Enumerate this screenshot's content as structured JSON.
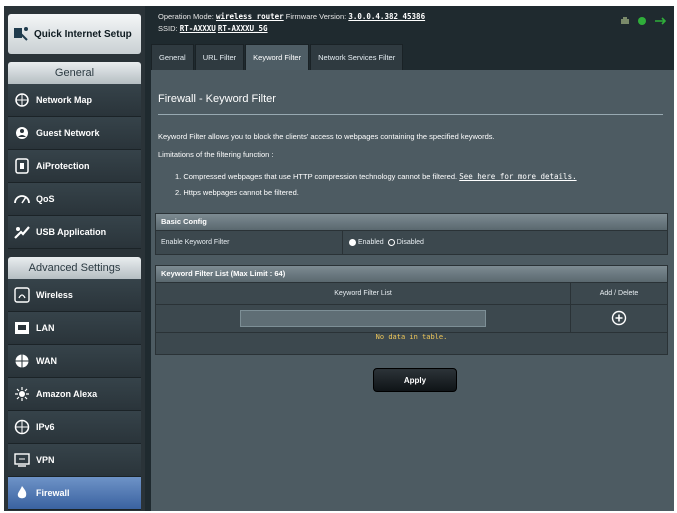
{
  "header": {
    "operation_mode_label": "Operation Mode:",
    "operation_mode_value": "wireless router",
    "firmware_label": "Firmware Version:",
    "firmware_value": "3.0.0.4.382_45386",
    "ssid_label": "SSID:",
    "ssid_1": "RT-AXXXU",
    "ssid_2": "RT-AXXXU_5G"
  },
  "sidebar": {
    "quick_setup": "Quick Internet Setup",
    "general_header": "General",
    "general_items": [
      {
        "label": "Network Map",
        "icon": "network-map-icon"
      },
      {
        "label": "Guest Network",
        "icon": "guest-network-icon"
      },
      {
        "label": "AiProtection",
        "icon": "shield-icon"
      },
      {
        "label": "QoS",
        "icon": "speedometer-icon"
      },
      {
        "label": "USB Application",
        "icon": "puzzle-icon"
      }
    ],
    "advanced_header": "Advanced Settings",
    "advanced_items": [
      {
        "label": "Wireless",
        "icon": "wifi-icon"
      },
      {
        "label": "LAN",
        "icon": "lan-icon"
      },
      {
        "label": "WAN",
        "icon": "globe-icon"
      },
      {
        "label": "Amazon Alexa",
        "icon": "alexa-icon"
      },
      {
        "label": "IPv6",
        "icon": "ipv6-globe-icon"
      },
      {
        "label": "VPN",
        "icon": "vpn-icon"
      },
      {
        "label": "Firewall",
        "icon": "firewall-icon"
      }
    ]
  },
  "tabs": [
    "General",
    "URL Filter",
    "Keyword Filter",
    "Network Services Filter"
  ],
  "active_tab": "Keyword Filter",
  "page": {
    "title": "Firewall - Keyword Filter",
    "description": "Keyword Filter allows you to block the clients' access to webpages containing the specified keywords.",
    "limitations_heading": "Limitations of the filtering function :",
    "limitation_1": "1. Compressed webpages that use HTTP compression technology cannot be filtered.",
    "limitation_1_link": "See here for more details.",
    "limitation_2": "2. Https webpages cannot be filtered."
  },
  "basic_config": {
    "header": "Basic Config",
    "enable_label": "Enable Keyword Filter",
    "option_enabled": "Enabled",
    "option_disabled": "Disabled",
    "selected": "Enabled"
  },
  "keyword_list": {
    "header": "Keyword Filter List (Max Limit : 64)",
    "col_keyword": "Keyword Filter List",
    "col_action": "Add / Delete",
    "input_value": "",
    "empty_text": "No data in table."
  },
  "apply_label": "Apply",
  "colors": {
    "active_nav": "#4a74b4",
    "no_data": "#f0c85a"
  }
}
